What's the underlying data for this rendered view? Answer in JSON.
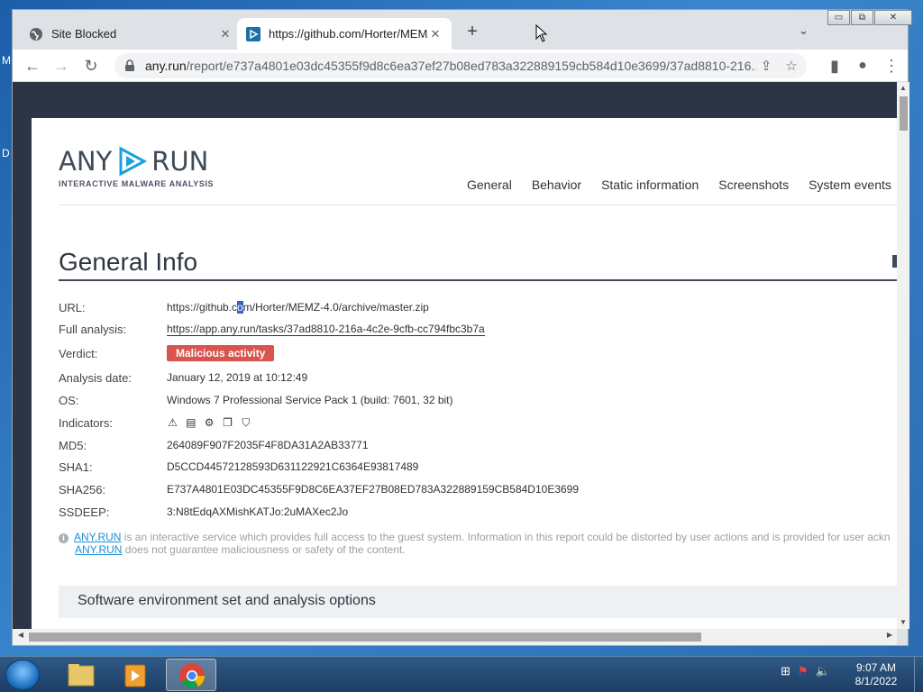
{
  "desktop": {
    "left_letters": [
      "M",
      "D"
    ]
  },
  "browser": {
    "tabs": [
      {
        "title": "Site Blocked",
        "close": "✕"
      },
      {
        "title": "https://github.com/Horter/MEMZ",
        "close": "✕"
      }
    ],
    "new_tab": "+",
    "tab_search": "⌄",
    "window_controls": {
      "minimize": "▭",
      "maximize": "⧉",
      "close": "✕"
    },
    "nav": {
      "back": "←",
      "forward": "→",
      "reload": "↻"
    },
    "address": {
      "host": "any.run",
      "path": "/report/e737a4801e03dc45355f9d8c6ea37ef27b08ed783a322889159cb584d10e3699/37ad8810-216..."
    }
  },
  "page": {
    "logo": {
      "left": "ANY",
      "right": "RUN",
      "tagline": "INTERACTIVE MALWARE ANALYSIS"
    },
    "nav": [
      "General",
      "Behavior",
      "Static information",
      "Screenshots",
      "System events"
    ],
    "heading": "General Info",
    "fields": [
      {
        "key": "URL:",
        "value_pre": "https://github.c",
        "value_sel": "o",
        "value_post": "m/Horter/MEMZ-4.0/archive/master.zip"
      },
      {
        "key": "Full analysis:",
        "value": "https://app.any.run/tasks/37ad8810-216a-4c2e-9cfb-cc794fbc3b7a"
      },
      {
        "key": "Verdict:",
        "value": "Malicious activity"
      },
      {
        "key": "Analysis date:",
        "value": "January 12, 2019 at 10:12:49"
      },
      {
        "key": "OS:",
        "value": "Windows 7 Professional Service Pack 1 (build: 7601, 32 bit)"
      },
      {
        "key": "Indicators:",
        "icons": [
          "warning-icon",
          "monitor-icon",
          "process-icon",
          "windows-icon",
          "shield-icon"
        ]
      },
      {
        "key": "MD5:",
        "value": "264089F907F2035F4F8DA31A2AB33771"
      },
      {
        "key": "SHA1:",
        "value": "D5CCD44572128593D631122921C6364E93817489"
      },
      {
        "key": "SHA256:",
        "value": "E737A4801E03DC45355F9D8C6EA37EF27B08ED783A322889159CB584D10E3699"
      },
      {
        "key": "SSDEEP:",
        "value": "3:N8tEdqAXMishKATJo:2uMAXec2Jo"
      }
    ],
    "notice": {
      "link": "ANY.RUN",
      "line1": " is an interactive service which provides full access to the guest system. Information in this report could be distorted by user actions and is provided for user ackn",
      "line2": " does not guarantee maliciousness or safety of the content."
    },
    "section_title": "Software environment set and analysis options"
  },
  "taskbar": {
    "time": "9:07 AM",
    "date": "8/1/2022"
  },
  "colors": {
    "verdict": "#d9534f",
    "link": "#1a8fd6",
    "page_bg": "#2b3545"
  }
}
